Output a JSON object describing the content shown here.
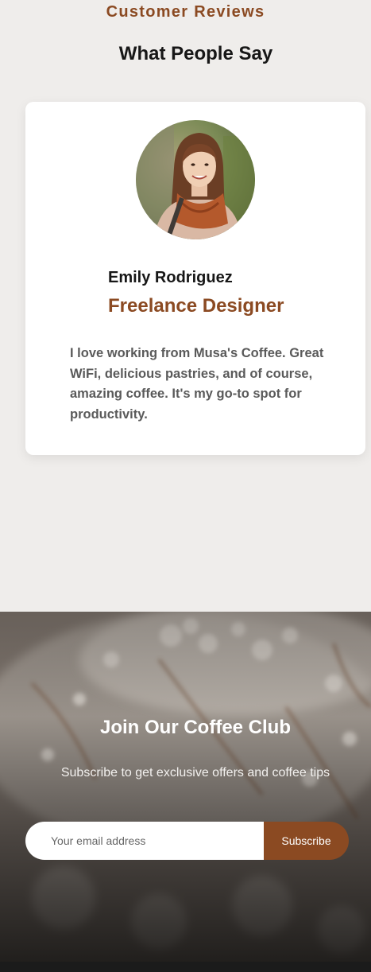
{
  "reviews": {
    "eyebrow": "Customer Reviews",
    "title": "What People Say",
    "testimonial": {
      "name": "Emily Rodriguez",
      "role": "Freelance Designer",
      "quote": "I love working from Musa's Coffee. Great WiFi, delicious pastries, and of course, amazing coffee. It's my go-to spot for productivity."
    }
  },
  "newsletter": {
    "title": "Join Our Coffee Club",
    "subtitle": "Subscribe to get exclusive offers and coffee tips",
    "email_placeholder": "Your email address",
    "subscribe_label": "Subscribe"
  },
  "colors": {
    "accent": "#8b4a22",
    "section_bg": "#efedeb",
    "card_bg": "#ffffff"
  }
}
